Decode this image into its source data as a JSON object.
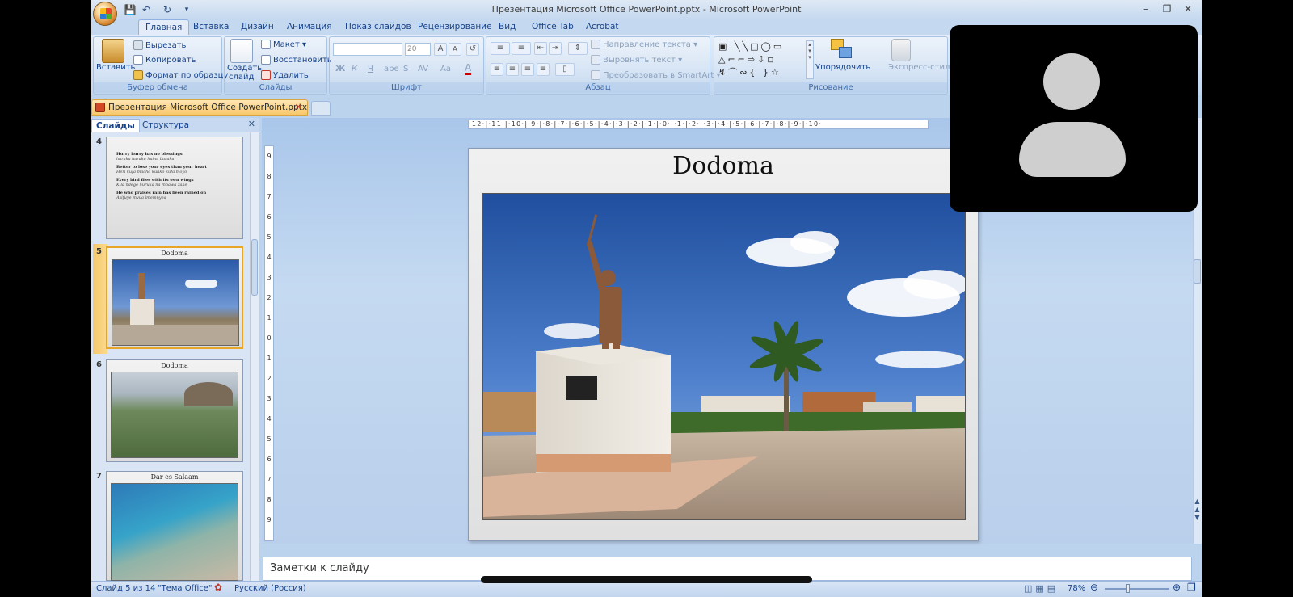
{
  "app": {
    "title": "Презентация Microsoft Office PowerPoint.pptx - Microsoft PowerPoint",
    "quick_access": [
      "save-icon",
      "undo-icon",
      "redo-icon"
    ]
  },
  "tabs": [
    "Главная",
    "Вставка",
    "Дизайн",
    "Анимация",
    "Показ слайдов",
    "Рецензирование",
    "Вид",
    "Office Tab",
    "Acrobat"
  ],
  "active_tab": "Главная",
  "ribbon": {
    "clipboard": {
      "paste": "Вставить",
      "cut": "Вырезать",
      "copy": "Копировать",
      "format_painter": "Формат по образцу",
      "label": "Буфер обмена"
    },
    "slides": {
      "new_slide_1": "Создать",
      "new_slide_2": "слайд",
      "layout": "Макет",
      "reset": "Восстановить",
      "delete": "Удалить",
      "label": "Слайды"
    },
    "font": {
      "size": "20",
      "bold": "Ж",
      "italic": "К",
      "underline": "Ч",
      "shadow": "abe",
      "strike": "S",
      "spacing": "AV",
      "case": "Aa",
      "color": "A",
      "grow": "A",
      "shrink": "A",
      "label": "Шрифт"
    },
    "paragraph": {
      "text_direction": "Направление текста",
      "align_text": "Выровнять текст",
      "smartart": "Преобразовать в SmartArt",
      "label": "Абзац"
    },
    "drawing": {
      "arrange": "Упорядочить",
      "quick_styles": "Экспресс-стили",
      "label": "Рисование"
    }
  },
  "doc_tab": {
    "title": "Презентация Microsoft Office PowerPoint.pptx"
  },
  "left_pane": {
    "tabs": [
      "Слайды",
      "Структура"
    ],
    "slides": [
      {
        "num": "4",
        "title": "",
        "proverbs": [
          [
            "Hurry hurry has no blessings",
            "haraka haraka haina baraka"
          ],
          [
            "Better to lose your eyes than your heart",
            "Heri kufa macho kuliko kufa moyo"
          ],
          [
            "Every bird flies with its own wings",
            "Kila ndege huruka na mbawa zake"
          ],
          [
            "He who praises rain has been rained on",
            "Asifuye mvua imemnyea"
          ]
        ]
      },
      {
        "num": "5",
        "title": "Dodoma"
      },
      {
        "num": "6",
        "title": "Dodoma"
      },
      {
        "num": "7",
        "title": "Dar es Salaam"
      }
    ]
  },
  "slide": {
    "title": "Dodoma"
  },
  "ruler": {
    "h": "·12·|·11·|·10·|·9·|·8·|·7·|·6·|·5·|·4·|·3·|·2·|·1·|·0·|·1·|·2·|·3·|·4·|·5·|·6·|·7·|·8·|·9·|·10·",
    "v": [
      "9",
      "8",
      "7",
      "6",
      "5",
      "4",
      "3",
      "2",
      "1",
      "0",
      "1",
      "2",
      "3",
      "4",
      "5",
      "6",
      "7",
      "8",
      "9"
    ]
  },
  "notes": {
    "placeholder": "Заметки к слайду"
  },
  "status": {
    "slide": "Слайд 5 из 14",
    "theme": "\"Тема Office\"",
    "language": "Русский (Россия)",
    "zoom": "78%"
  }
}
